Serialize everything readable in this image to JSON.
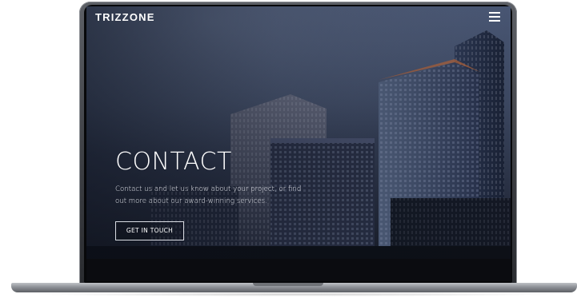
{
  "site": {
    "brand": "TRIZZONE",
    "menu_icon": "hamburger-menu-icon"
  },
  "hero": {
    "title": "CONTACT",
    "text": "Contact us and let us know about your project, or find out more about our award-winning services.",
    "cta_label": "GET IN TOUCH"
  },
  "colors": {
    "text": "#ffffff",
    "overlay": "#1b2233",
    "device_frame": "#3b3d42"
  }
}
